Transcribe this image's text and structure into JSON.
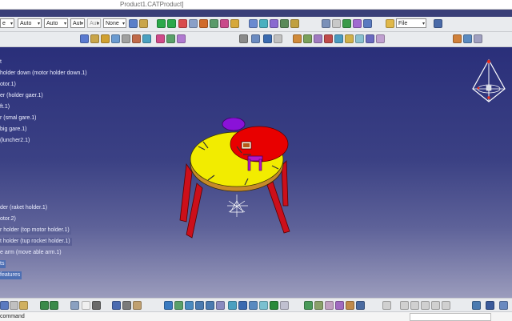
{
  "window": {
    "title": "Product1.CATProduct]"
  },
  "toolbar": {
    "combos": [
      {
        "value": "e",
        "disabled": false
      },
      {
        "value": "Auto",
        "disabled": false
      },
      {
        "value": "Auto",
        "disabled": false
      },
      {
        "value": "Aut",
        "disabled": false
      },
      {
        "value": "Aut",
        "disabled": true
      },
      {
        "value": "None",
        "disabled": false
      }
    ],
    "file_combo": "File"
  },
  "tree": {
    "items": [
      {
        "label": "t",
        "state": "normal"
      },
      {
        "label": "holder down (motor holder down.1)",
        "state": "normal"
      },
      {
        "label": "otor.1)",
        "state": "normal"
      },
      {
        "label": "er (holder gaer.1)",
        "state": "normal"
      },
      {
        "label": "ft.1)",
        "state": "normal"
      },
      {
        "label": "r (smal gare.1)",
        "state": "normal"
      },
      {
        "label": "big gare.1)",
        "state": "normal"
      },
      {
        "label": "(luncher2.1)",
        "state": "normal"
      },
      {
        "label": "",
        "state": "normal"
      },
      {
        "label": "",
        "state": "normal"
      },
      {
        "label": "",
        "state": "normal"
      },
      {
        "label": "",
        "state": "normal"
      },
      {
        "label": "",
        "state": "normal"
      },
      {
        "label": "der (raket holder.1)",
        "state": "normal"
      },
      {
        "label": "otor.2)",
        "state": "normal"
      },
      {
        "label": "r holder (top motor holder.1)",
        "state": "selected"
      },
      {
        "label": "t holder (tup rocket holder.1)",
        "state": "selected"
      },
      {
        "label": "e arm (move able arm.1)",
        "state": "normal"
      },
      {
        "label": "ts",
        "state": "selected"
      },
      {
        "label": "features",
        "state": "selected"
      }
    ]
  },
  "status": {
    "message": "command"
  },
  "colors": {
    "table_top": "#f2ec00",
    "table_edge": "#c68a2a",
    "gear_big": "#e80000",
    "gear_small": "#8a12d8",
    "legs": "#cc0f1a",
    "accent": "#4d6fb3"
  }
}
